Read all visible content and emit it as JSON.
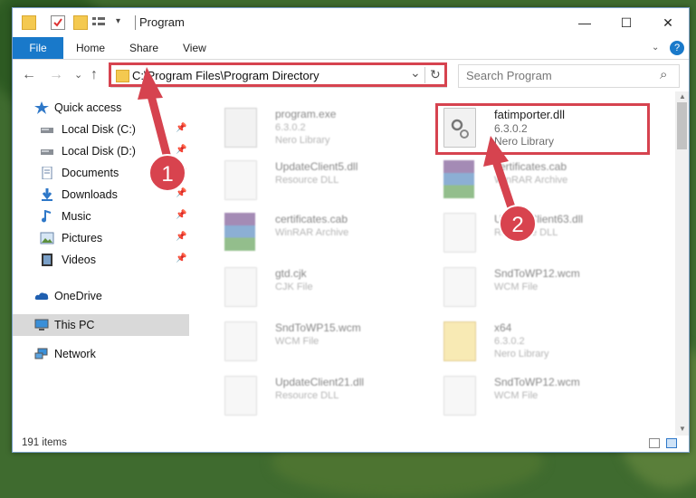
{
  "window": {
    "title": "Program",
    "controls": [
      "—",
      "☐",
      "✕"
    ]
  },
  "ribbon": {
    "tabs": [
      "File",
      "Home",
      "Share",
      "View"
    ],
    "help": "?"
  },
  "address": {
    "path": "C:\\Program Files\\Program Directory",
    "dropdown": "⌄",
    "refresh": "↻"
  },
  "search": {
    "placeholder": "Search Program",
    "icon": "⌕"
  },
  "nav_buttons": {
    "back": "←",
    "forward": "→",
    "recent": "⌄",
    "up": "↑"
  },
  "sidebar": {
    "items": [
      {
        "label": "Quick access",
        "icon": "star-icon"
      },
      {
        "label": "Local Disk (C:)",
        "icon": "drive-icon",
        "pin": "📌"
      },
      {
        "label": "Local Disk (D:)",
        "icon": "drive-icon",
        "pin": "📌"
      },
      {
        "label": "Documents",
        "icon": "documents-icon",
        "pin": "📌"
      },
      {
        "label": "Downloads",
        "icon": "download-icon",
        "pin": "📌"
      },
      {
        "label": "Music",
        "icon": "music-icon",
        "pin": "📌"
      },
      {
        "label": "Pictures",
        "icon": "pictures-icon",
        "pin": "📌"
      },
      {
        "label": "Videos",
        "icon": "videos-icon",
        "pin": "📌"
      },
      {
        "label": "OneDrive",
        "icon": "cloud-icon"
      },
      {
        "label": "This PC",
        "icon": "computer-icon"
      },
      {
        "label": "Network",
        "icon": "network-icon"
      }
    ]
  },
  "files": [
    {
      "name": "program.exe",
      "version": "6.3.0.2",
      "desc": "Nero Library",
      "icon": "exe-icon"
    },
    {
      "name": "fatimporter.dll",
      "version": "6.3.0.2",
      "desc": "Nero Library",
      "icon": "dll-gear-icon"
    },
    {
      "name": "UpdateClient5.dll",
      "version": "",
      "desc": "Resource DLL",
      "icon": "dll-gear-icon"
    },
    {
      "name": "certificates.cab",
      "version": "",
      "desc": "WinRAR Archive",
      "icon": "winrar-icon"
    },
    {
      "name": "certificates.cab",
      "version": "",
      "desc": "WinRAR Archive",
      "icon": "winrar-icon"
    },
    {
      "name": "UpdateClient63.dll",
      "version": "",
      "desc": "Resource DLL",
      "icon": "dll-gear-icon"
    },
    {
      "name": "gtd.cjk",
      "version": "",
      "desc": "CJK File",
      "icon": "blank-file-icon"
    },
    {
      "name": "SndToWP12.wcm",
      "version": "",
      "desc": "WCM File",
      "icon": "blank-file-icon"
    },
    {
      "name": "SndToWP15.wcm",
      "version": "",
      "desc": "WCM File",
      "icon": "blank-file-icon"
    },
    {
      "name": "x64",
      "version": "6.3.0.2",
      "desc": "Nero Library",
      "icon": "folder-file-icon"
    },
    {
      "name": "UpdateClient21.dll",
      "version": "",
      "desc": "Resource DLL",
      "icon": "dll-gear-icon"
    },
    {
      "name": "SndToWP12.wcm",
      "version": "",
      "desc": "WCM File",
      "icon": "blank-file-icon"
    }
  ],
  "status": {
    "count": "191 items"
  },
  "annotations": {
    "step1": "1",
    "step2": "2",
    "color": "#d6434f"
  }
}
